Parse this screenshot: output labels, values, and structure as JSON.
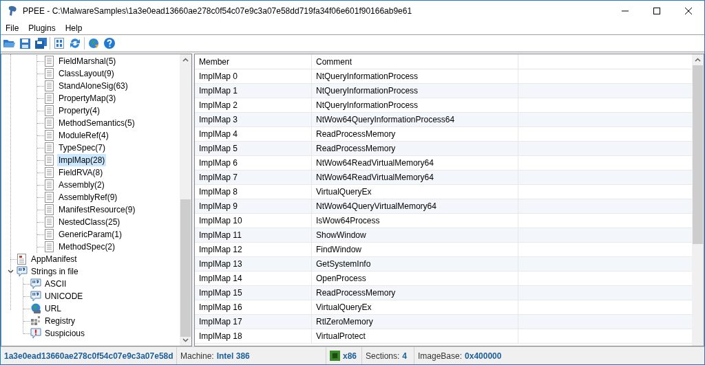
{
  "window": {
    "title": "PPEE - C:\\MalwareSamples\\1a3e0ead13660ae278c0f54c07e9c3a07e58dd719fa34f06e601f90166ab9e61"
  },
  "menu": [
    {
      "label": "File"
    },
    {
      "label": "Plugins"
    },
    {
      "label": "Help"
    }
  ],
  "tree": {
    "nested_items": [
      {
        "label": "FieldMarshal(5)",
        "selected": false
      },
      {
        "label": "ClassLayout(9)",
        "selected": false
      },
      {
        "label": "StandAloneSig(63)",
        "selected": false
      },
      {
        "label": "PropertyMap(3)",
        "selected": false
      },
      {
        "label": "Property(4)",
        "selected": false
      },
      {
        "label": "MethodSemantics(5)",
        "selected": false
      },
      {
        "label": "ModuleRef(4)",
        "selected": false
      },
      {
        "label": "TypeSpec(7)",
        "selected": false
      },
      {
        "label": "ImplMap(28)",
        "selected": true
      },
      {
        "label": "FieldRVA(8)",
        "selected": false
      },
      {
        "label": "Assembly(2)",
        "selected": false
      },
      {
        "label": "AssemblyRef(9)",
        "selected": false
      },
      {
        "label": "ManifestResource(9)",
        "selected": false
      },
      {
        "label": "NestedClass(25)",
        "selected": false
      },
      {
        "label": "GenericParam(1)",
        "selected": false
      },
      {
        "label": "MethodSpec(2)",
        "selected": false
      }
    ],
    "items": [
      {
        "label": "AppManifest",
        "kind": "manifest",
        "selected": false
      },
      {
        "label": "Strings in file",
        "kind": "strings",
        "selected": false,
        "expanded": true,
        "children": [
          {
            "label": "ASCII",
            "kind": "strings",
            "selected": false
          },
          {
            "label": "UNICODE",
            "kind": "strings",
            "selected": false
          },
          {
            "label": "URL",
            "kind": "globe",
            "selected": false
          },
          {
            "label": "Registry",
            "kind": "registry",
            "selected": false
          },
          {
            "label": "Suspicious",
            "kind": "suspicious",
            "selected": false
          }
        ]
      }
    ]
  },
  "table": {
    "columns": [
      "Member",
      "Comment"
    ],
    "rows": [
      [
        "ImplMap 0",
        "NtQueryInformationProcess"
      ],
      [
        "ImplMap 1",
        "NtQueryInformationProcess"
      ],
      [
        "ImplMap 2",
        "NtQueryInformationProcess"
      ],
      [
        "ImplMap 3",
        "NtWow64QueryInformationProcess64"
      ],
      [
        "ImplMap 4",
        "ReadProcessMemory"
      ],
      [
        "ImplMap 5",
        "ReadProcessMemory"
      ],
      [
        "ImplMap 6",
        "NtWow64ReadVirtualMemory64"
      ],
      [
        "ImplMap 7",
        "NtWow64ReadVirtualMemory64"
      ],
      [
        "ImplMap 8",
        "VirtualQueryEx"
      ],
      [
        "ImplMap 9",
        "NtWow64QueryVirtualMemory64"
      ],
      [
        "ImplMap 10",
        "IsWow64Process"
      ],
      [
        "ImplMap 11",
        "ShowWindow"
      ],
      [
        "ImplMap 12",
        "FindWindow"
      ],
      [
        "ImplMap 13",
        "GetSystemInfo"
      ],
      [
        "ImplMap 14",
        "OpenProcess"
      ],
      [
        "ImplMap 15",
        "ReadProcessMemory"
      ],
      [
        "ImplMap 16",
        "VirtualQueryEx"
      ],
      [
        "ImplMap 17",
        "RtlZeroMemory"
      ],
      [
        "ImplMap 18",
        "VirtualProtect"
      ]
    ]
  },
  "status_bar": {
    "file": "1a3e0ead13660ae278c0f54c07e9c3a07e58d",
    "machine_label": "Machine:",
    "machine": "Intel 386",
    "arch": "x86",
    "sections_label": "Sections:",
    "sections": "4",
    "imagebase_label": "ImageBase:",
    "imagebase": "0x400000"
  }
}
